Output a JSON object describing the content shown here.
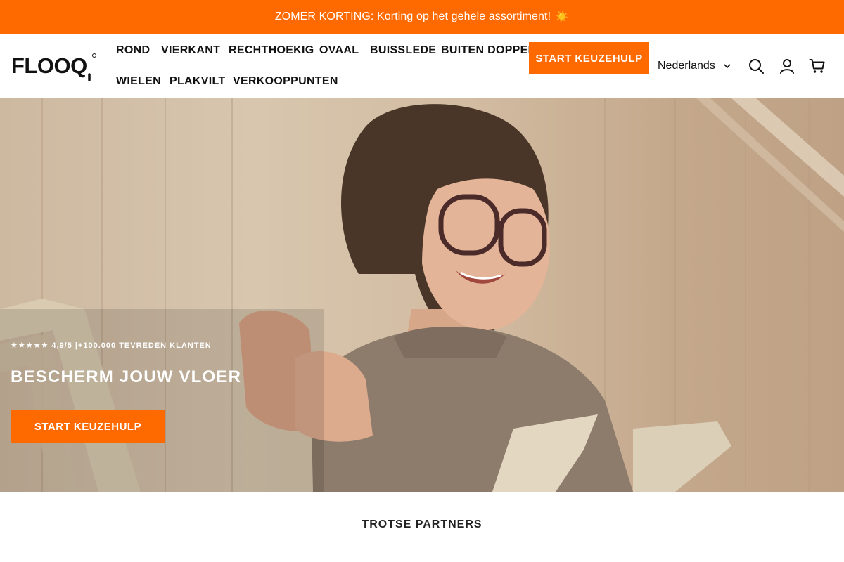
{
  "announcement": {
    "text": "ZOMER KORTING: Korting op het gehele assortiment!",
    "emoji": "☀️"
  },
  "header": {
    "logo_text": "FLOOQ",
    "nav": [
      "ROND",
      "VIERKANT",
      "RECHTHOEKIG",
      "OVAAL",
      "BUISSLEDE",
      "BUITEN DOPPEN",
      "WIELEN",
      "PLAKVILT",
      "VERKOOPPUNTEN"
    ],
    "cta_label": "START KEUZEHULP",
    "language": "Nederlands",
    "icons": [
      "search-icon",
      "account-icon",
      "cart-icon"
    ]
  },
  "hero": {
    "rating_text": "★★★★★ 4,9/5 |+100.000 TEVREDEN KLANTEN",
    "title": "BESCHERM JOUW VLOER",
    "cta_label": "START KEUZEHULP"
  },
  "partners": {
    "title": "TROTSE PARTNERS"
  },
  "colors": {
    "accent": "#ff6a00",
    "text": "#111111",
    "hero_text": "#ffffff"
  }
}
